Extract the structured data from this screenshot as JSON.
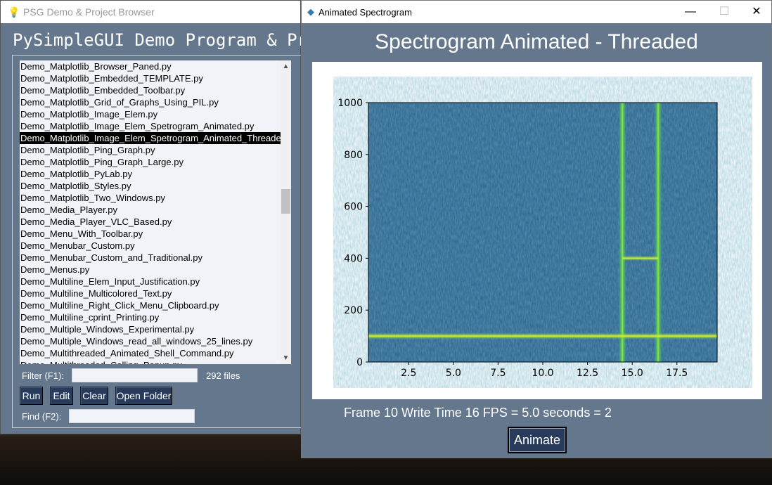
{
  "browser": {
    "title": "PSG Demo & Project Browser",
    "heading": "PySimpleGUI Demo Program & Project Browser",
    "files": [
      "Demo_Matplotlib_Browser_Paned.py",
      "Demo_Matplotlib_Embedded_TEMPLATE.py",
      "Demo_Matplotlib_Embedded_Toolbar.py",
      "Demo_Matplotlib_Grid_of_Graphs_Using_PIL.py",
      "Demo_Matplotlib_Image_Elem.py",
      "Demo_Matplotlib_Image_Elem_Spetrogram_Animated.py",
      "Demo_Matplotlib_Image_Elem_Spetrogram_Animated_Threaded.py",
      "Demo_Matplotlib_Ping_Graph.py",
      "Demo_Matplotlib_Ping_Graph_Large.py",
      "Demo_Matplotlib_PyLab.py",
      "Demo_Matplotlib_Styles.py",
      "Demo_Matplotlib_Two_Windows.py",
      "Demo_Media_Player.py",
      "Demo_Media_Player_VLC_Based.py",
      "Demo_Menu_With_Toolbar.py",
      "Demo_Menubar_Custom.py",
      "Demo_Menubar_Custom_and_Traditional.py",
      "Demo_Menus.py",
      "Demo_Multiline_Elem_Input_Justification.py",
      "Demo_Multiline_Multicolored_Text.py",
      "Demo_Multiline_Right_Click_Menu_Clipboard.py",
      "Demo_Multiline_cprint_Printing.py",
      "Demo_Multiple_Windows_Experimental.py",
      "Demo_Multiple_Windows_read_all_windows_25_lines.py",
      "Demo_Multithreaded_Animated_Shell_Command.py",
      "Demo_Multithreaded_Calling_Popup.py"
    ],
    "selected_index": 6,
    "filter_label": "Filter (F1):",
    "filter_value": "",
    "file_count": "292 files",
    "buttons": {
      "run": "Run",
      "edit": "Edit",
      "clear": "Clear",
      "open_folder": "Open Folder"
    },
    "find_label": "Find (F2):",
    "find_value": ""
  },
  "spectro": {
    "title": "Animated Spectrogram",
    "controls": {
      "minimize": "—",
      "maximize": "☐",
      "close": "✕"
    },
    "heading": "Spectrogram Animated - Threaded",
    "status": "Frame 10 Write Time 16 FPS = 5.0 seconds = 2",
    "animate_label": "Animate"
  },
  "chart_data": {
    "type": "heatmap",
    "xlim": [
      0.25,
      19.75
    ],
    "ylim": [
      0,
      1000
    ],
    "xticks": [
      "2.5",
      "5.0",
      "7.5",
      "10.0",
      "12.5",
      "15.0",
      "17.5"
    ],
    "yticks": [
      "0",
      "200",
      "400",
      "600",
      "800",
      "1000"
    ],
    "colormap": "viridis",
    "features": {
      "horizontal_tone_y": 100,
      "vertical_bursts_x": [
        14.45,
        16.45
      ],
      "segment_y": 400
    },
    "colors": {
      "background": "#2c6c8c",
      "line": "#e8f020"
    }
  }
}
